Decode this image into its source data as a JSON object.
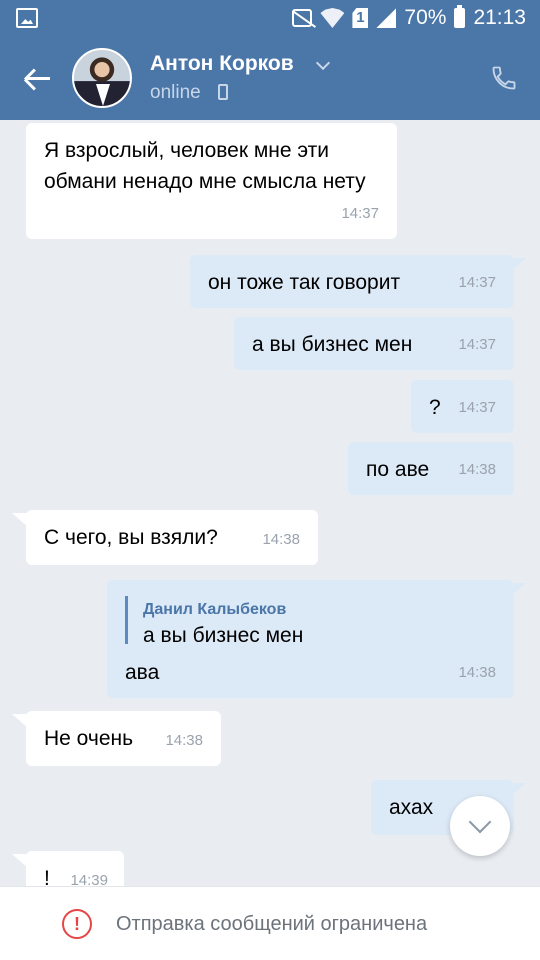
{
  "status_bar": {
    "battery": "70%",
    "time": "21:13",
    "sim": "1"
  },
  "header": {
    "contact_name": "Антон Корков",
    "presence": "online"
  },
  "messages": [
    {
      "dir": "in",
      "text": "Я взрослый, человек мне эти обмани ненадо мне смысла нету",
      "time": "14:37"
    },
    {
      "dir": "out",
      "text": "он тоже так говорит",
      "time": "14:37"
    },
    {
      "dir": "out",
      "text": "а вы бизнес мен",
      "time": "14:37"
    },
    {
      "dir": "out",
      "text": "?",
      "time": "14:37"
    },
    {
      "dir": "out",
      "text": "по аве",
      "time": "14:38"
    },
    {
      "dir": "in",
      "text": "С чего, вы взяли?",
      "time": "14:38"
    },
    {
      "dir": "out",
      "reply_author": "Данил Калыбеков",
      "reply_text": "а вы бизнес мен",
      "text": "ава",
      "time": "14:38"
    },
    {
      "dir": "in",
      "text": "Не очень",
      "time": "14:38"
    },
    {
      "dir": "out",
      "text": "ахах",
      "time": ""
    },
    {
      "dir": "in",
      "text": "!",
      "time": "14:39"
    }
  ],
  "footer": {
    "restriction_text": "Отправка сообщений ограничена"
  },
  "colors": {
    "header_bg": "#4a76a8",
    "chat_bg": "#e9edf2",
    "incoming_bubble": "#ffffff",
    "outgoing_bubble": "#dce9f7",
    "warning": "#e64646"
  }
}
